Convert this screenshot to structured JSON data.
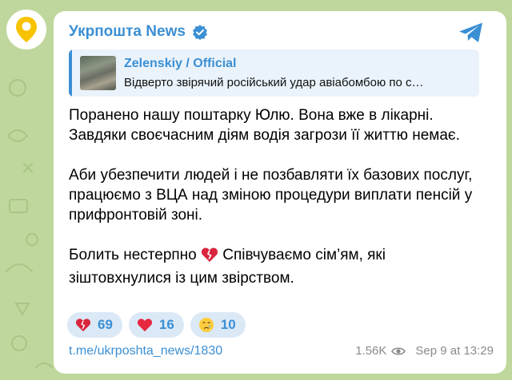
{
  "channel": {
    "name": "Укрпошта News",
    "verified": true
  },
  "forwarded": {
    "source": "Zelenskiy / Official",
    "preview": "Відверто звірячий російський удар авіабомбою по с…"
  },
  "message": {
    "paragraphs": [
      "Поранено нашу поштарку Юлю. Вона вже в лікарні. Завдяки своєчасним діям водія загрози її життю немає.",
      "Аби убезпечити людей і не позбавляти їх базових послуг, працюємо з ВЦА над зміною процедури виплати пенсій у прифронтовій зоні."
    ],
    "last_before": "Болить нестерпно",
    "last_after": "Співчуваємо сім’ям, які зіштовхнулися із цим звірством."
  },
  "reactions": [
    {
      "icon": "broken-heart-icon",
      "count": "69"
    },
    {
      "icon": "red-heart-icon",
      "count": "16"
    },
    {
      "icon": "crying-face-icon",
      "count": "10"
    }
  ],
  "footer": {
    "link": "t.me/ukrposhta_news/1830",
    "views": "1.56K",
    "date": "Sep 9 at 13:29"
  },
  "colors": {
    "accent": "#3b8fd4",
    "background": "#bfd79c",
    "brand_yellow": "#f7c200"
  }
}
